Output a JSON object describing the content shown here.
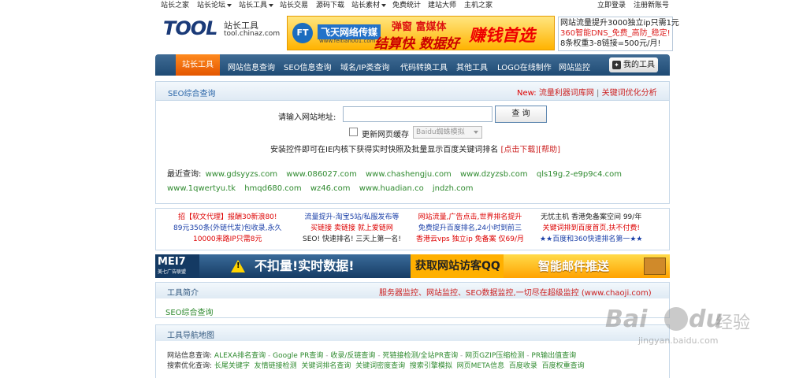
{
  "topbar": {
    "left": [
      "站长之家",
      "站长论坛",
      "站长工具",
      "站长交易",
      "源码下载",
      "站长素材",
      "免费统计",
      "建站大师",
      "主机之家"
    ],
    "right": [
      "立即登录",
      "注册新账号"
    ]
  },
  "logo": {
    "word": "TOOL",
    "cn": "站长工具",
    "en": "tool.chinaz.com"
  },
  "banner": {
    "brand": "飞天网络传媒",
    "brand_url": "www.feitian001.com",
    "slogan1": "弹窗 富媒体",
    "slogan2": "结算快 数据好",
    "slogan3": "赚钱首选"
  },
  "ad_right": [
    "网站流量提升3000独立ip只需1元",
    "360智能DNS_免费_高防_稳定!",
    "8条权重3-8链接=500元/月!"
  ],
  "nav": {
    "active": "站长工具",
    "items": [
      "网站信息查询",
      "SEO信息查询",
      "域名/IP类查询",
      "代码转换工具",
      "其他工具",
      "LOGO在线制作",
      "网站监控"
    ],
    "my_tools": "我的工具"
  },
  "seo": {
    "title": "SEO综合查询",
    "new_label": "New:",
    "links": [
      "流量利器词库网",
      "关键词优化分析"
    ],
    "input_label": "请输入网站地址:",
    "input_value": "",
    "query_button": "查 询",
    "refresh_label": "更新网页缓存",
    "spider_select": "Baidu蜘蛛模拟",
    "install_text": "安装控件即可在IE内核下获得实时快照及批量显示百度关键词排名",
    "download_link": "[点击下载]",
    "help_link": "[帮助]",
    "recent_label": "最近查询:",
    "recent_row1": [
      "www.gdsyyzs.com",
      "www.086027.com",
      "www.chashengju.com",
      "www.dzyzsb.com",
      "qls19g.2-e9p9c4.com"
    ],
    "recent_row2": [
      "www.1qwertyu.tk",
      "hmqd680.com",
      "wz46.com",
      "www.huadian.co",
      "jndzh.com"
    ]
  },
  "ads": {
    "col1": [
      "招【软文代理】报酬30新浪80!",
      "89元350条(外链代发)包收录,永久",
      "10000来路IP只需8元"
    ],
    "col2": [
      "流量提升-淘宝5站/私服发布等",
      "买链接 卖链接 就上爱链网",
      "SEO! 快速排名! 三天上第一名!"
    ],
    "col3": [
      "网站流量,广告点击,世界排名提升",
      "免费提升百度排名,24小时到前三",
      "香港云vps 独立ip 免备案 仅69/月"
    ],
    "col4": [
      "无忧主机 香港免备案空间 99/年",
      "关键词排到百度首页,扶不付费!",
      "★★百度和360快速排名第一★★"
    ]
  },
  "bigbanner": {
    "mei": "MEI7",
    "mei_sub": "美七广告联盟",
    "text1": "不扣量!实时数据!",
    "text2": "获取网站访客QQ",
    "text3": "智能邮件推送"
  },
  "intro": {
    "title": "工具简介",
    "right_text": "服务器监控、网站监控、SEO数据监控,一切尽在超级监控 (www.chaoji.com)",
    "body": "SEO综合查询"
  },
  "sitemap": {
    "title": "工具导航地图",
    "row1_label": "网站信息查询:",
    "row1": [
      "ALEXA排名查询",
      "Google PR查询",
      "收录/反链查询",
      "死链接检测/全站PR查询",
      "网页GZIP压缩检测",
      "PR输出值查询"
    ],
    "row2_label": "搜索优化查询:",
    "row2": [
      "长尾关键字",
      "友情链接检测",
      "关键词排名查询",
      "关键词密度查询",
      "搜索引擎模拟",
      "网页META信息",
      "百度收录",
      "百度权重查询"
    ]
  },
  "watermark": {
    "bai": "Bai",
    "du": "du",
    "jingyan": "经验",
    "url": "jingyan.baidu.com"
  }
}
